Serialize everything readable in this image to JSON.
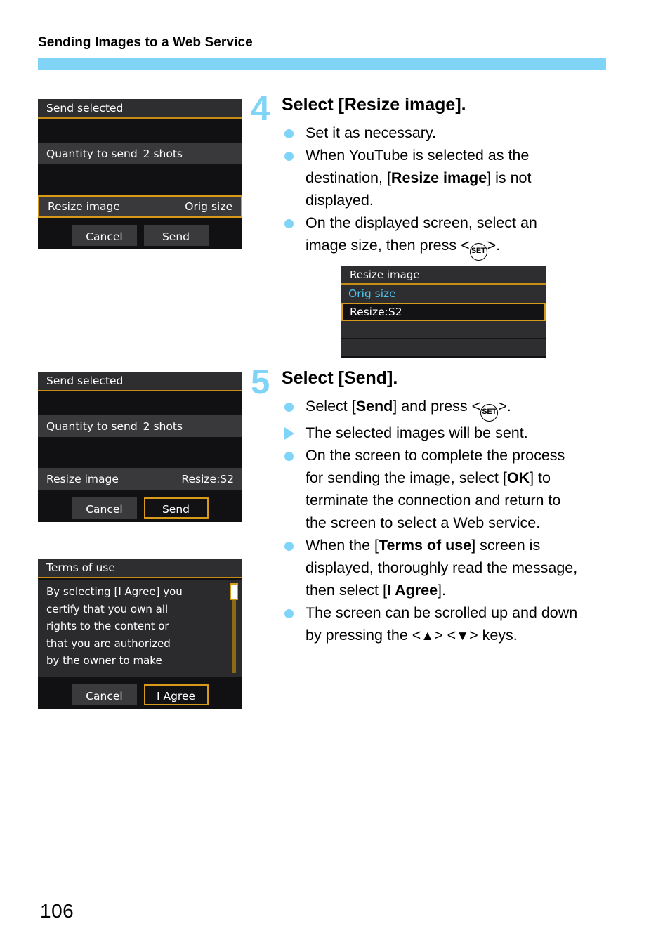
{
  "header": {
    "running_head": "Sending Images to a Web Service",
    "rule_color": "#7fd4f7"
  },
  "page_number": "106",
  "screens": {
    "send_selected_orig": {
      "title": "Send selected",
      "quantity_label": "Quantity to send",
      "quantity_value": "2 shots",
      "resize_label": "Resize image",
      "resize_value": "Orig size",
      "cancel_label": "Cancel",
      "send_label": "Send",
      "selected_item": "Resize image"
    },
    "send_selected_s2": {
      "title": "Send selected",
      "quantity_label": "Quantity to send",
      "quantity_value": "2 shots",
      "resize_label": "Resize image",
      "resize_value": "Resize:S2",
      "cancel_label": "Cancel",
      "send_label": "Send",
      "selected_item": "Send"
    },
    "resize_image_dialog": {
      "title": "Resize image",
      "option_orig": "Orig size",
      "option_s2": "Resize:S2",
      "selected_option": "Resize:S2",
      "orig_color": "#4ec3f0",
      "highlight_color": "#d99a1a"
    },
    "terms_of_use": {
      "title": "Terms of use",
      "body_lines": [
        "By selecting [I Agree] you",
        "certify that you own all",
        "rights to the content or",
        "that you are authorized",
        "by the owner to make"
      ],
      "cancel_label": "Cancel",
      "agree_label": "I Agree",
      "selected_item": "I Agree"
    }
  },
  "steps": [
    {
      "number": "4",
      "title": "Select [Resize image].",
      "bullets": [
        {
          "marker": "dot",
          "parts": [
            {
              "text": "Set it as necessary.",
              "bold": false
            }
          ]
        },
        {
          "marker": "dot",
          "parts": [
            {
              "text": "When YouTube is selected as the destination, [",
              "bold": false
            },
            {
              "text": "Resize image",
              "bold": true
            },
            {
              "text": "] is not displayed.",
              "bold": false
            }
          ]
        },
        {
          "marker": "dot",
          "parts": [
            {
              "text": "On the displayed screen, select an image size, then press <",
              "bold": false
            },
            {
              "text": "SET",
              "icon": "set-key"
            },
            {
              "text": ">.",
              "bold": false
            }
          ]
        }
      ]
    },
    {
      "number": "5",
      "title": "Select [Send].",
      "bullets": [
        {
          "marker": "dot",
          "parts": [
            {
              "text": "Select [",
              "bold": false
            },
            {
              "text": "Send",
              "bold": true
            },
            {
              "text": "] and press <",
              "bold": false
            },
            {
              "text": "SET",
              "icon": "set-key"
            },
            {
              "text": ">.",
              "bold": false
            }
          ]
        },
        {
          "marker": "triangle",
          "parts": [
            {
              "text": "The selected images will be sent.",
              "bold": false
            }
          ]
        },
        {
          "marker": "dot",
          "parts": [
            {
              "text": "On the screen to complete the process for sending the image, select [",
              "bold": false
            },
            {
              "text": "OK",
              "bold": true
            },
            {
              "text": "] to terminate the connection and return to the screen to select a Web service.",
              "bold": false
            }
          ]
        },
        {
          "marker": "dot",
          "parts": [
            {
              "text": "When the [",
              "bold": false
            },
            {
              "text": "Terms of use",
              "bold": true
            },
            {
              "text": "] screen is displayed, thoroughly read the message, then select [",
              "bold": false
            },
            {
              "text": "I Agree",
              "bold": true
            },
            {
              "text": "].",
              "bold": false
            }
          ]
        },
        {
          "marker": "dot",
          "parts": [
            {
              "text": "The screen can be scrolled up and down by pressing the <▲> <▼> keys.",
              "bold": false
            }
          ]
        }
      ]
    }
  ],
  "bullet_text": {
    "s4b1": "Set it as necessary.",
    "s4b2_a": "When YouTube is selected as the ",
    "s4b2_b": "destination, [",
    "s4b2_bold": "Resize image",
    "s4b2_c": "] is not displayed.",
    "s4b3_a": "On the displayed screen, select an image size, then press <",
    "s4b3_c": ">.",
    "s5b1_a": "Select [",
    "s5b1_bold": "Send",
    "s5b1_b": "] and press <",
    "s5b1_c": ">.",
    "s5b2": "The selected images will be sent.",
    "s5b3_a": "On the screen to complete the process for sending the image, select [",
    "s5b3_bold": "OK",
    "s5b3_b": "] to terminate the connection and return to the screen to select a Web service.",
    "s5b4_a": "When the [",
    "s5b4_bold1": "Terms of use",
    "s5b4_b": "] screen is displayed, thoroughly read the message, then select [",
    "s5b4_bold2": "I Agree",
    "s5b4_c": "].",
    "s5b5_a": "The screen can be scrolled up and down by pressing the <",
    "s5b5_up": "▲",
    "s5b5_mid": "> <",
    "s5b5_down": "▼",
    "s5b5_b": "> keys."
  },
  "set_key_label": "SET"
}
